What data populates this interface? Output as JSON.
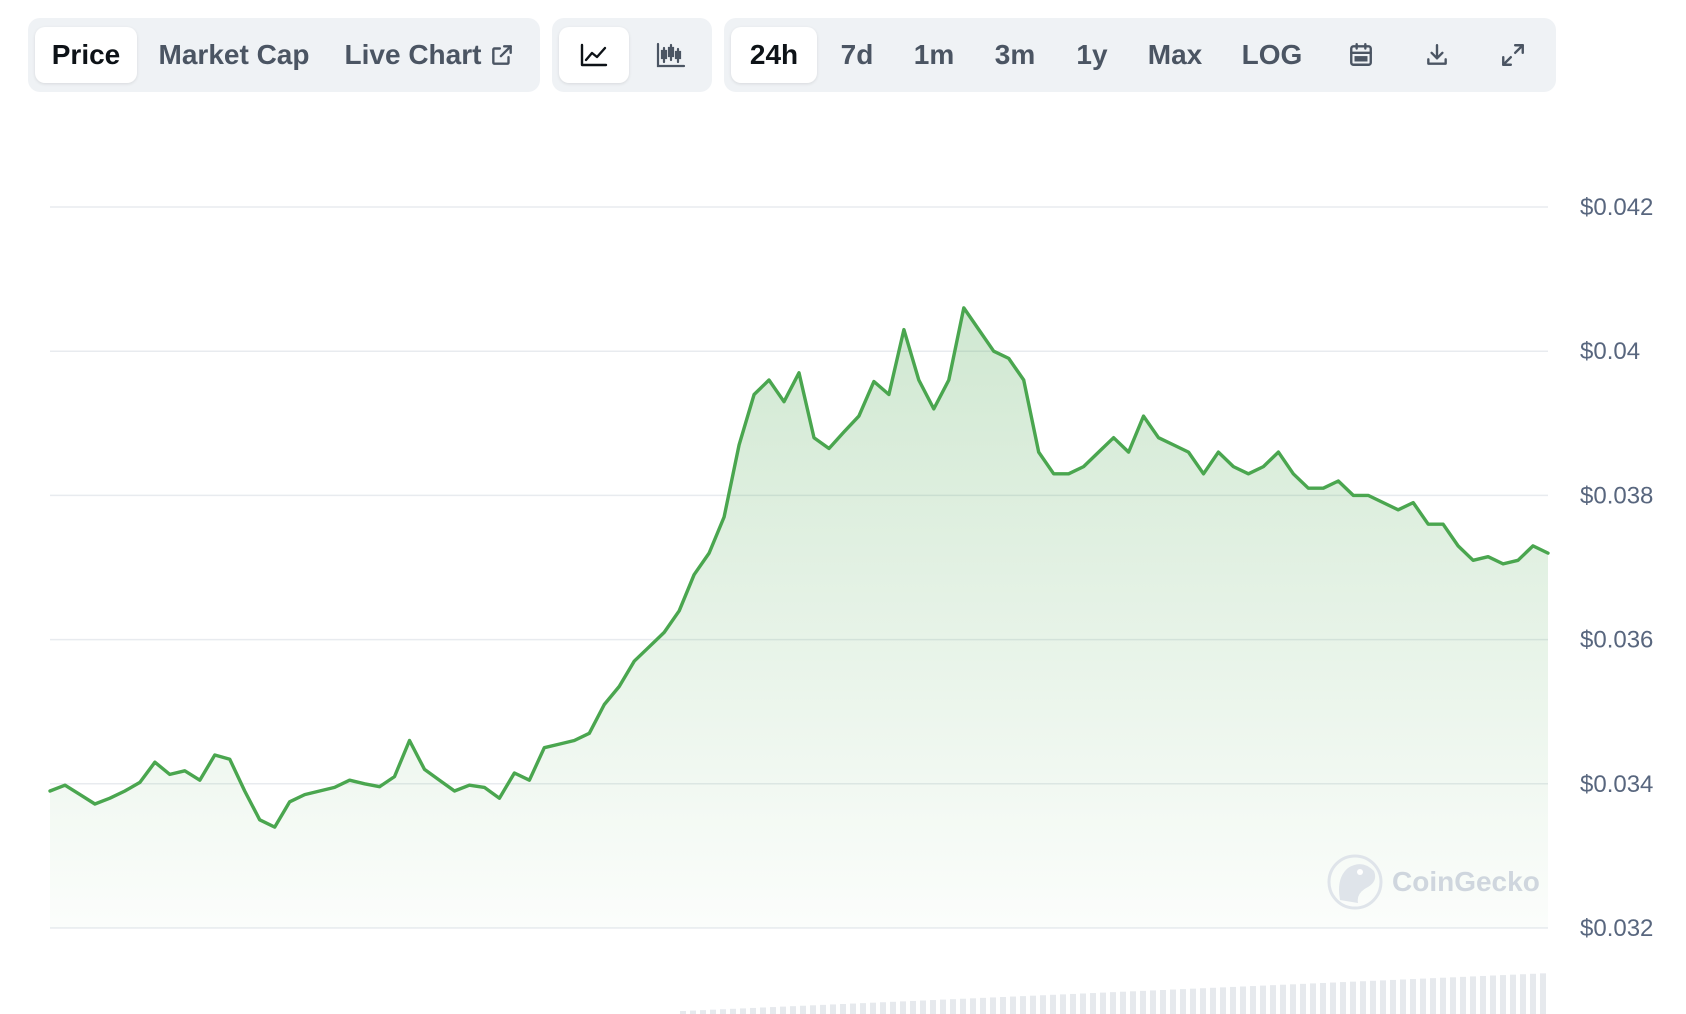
{
  "toolbar": {
    "view_tabs": [
      {
        "label": "Price",
        "active": true
      },
      {
        "label": "Market Cap",
        "active": false
      },
      {
        "label": "Live Chart",
        "active": false,
        "icon": "external-link-icon"
      }
    ],
    "chart_type_buttons": [
      {
        "icon": "line-chart-icon",
        "active": true
      },
      {
        "icon": "candlestick-chart-icon",
        "active": false
      }
    ],
    "ranges": [
      {
        "label": "24h",
        "active": true
      },
      {
        "label": "7d",
        "active": false
      },
      {
        "label": "1m",
        "active": false
      },
      {
        "label": "3m",
        "active": false
      },
      {
        "label": "1y",
        "active": false
      },
      {
        "label": "Max",
        "active": false
      },
      {
        "label": "LOG",
        "active": false
      }
    ],
    "tool_icons": [
      "calendar-icon",
      "download-icon",
      "expand-icon"
    ]
  },
  "watermark": {
    "text": "CoinGecko",
    "icon": "coingecko-logo-icon"
  },
  "colors": {
    "line": "#4aa64f",
    "fill": "#4aa64f",
    "grid": "#e8ebef",
    "axis_text": "#58667e",
    "active_text": "#0d1217",
    "inactive_text": "#4b5563",
    "toolbar_bg": "#eff2f5",
    "volume": "#e6e9ed"
  },
  "chart_data": {
    "type": "area",
    "title": "",
    "xlabel": "",
    "ylabel": "",
    "ylim": [
      0.032,
      0.042
    ],
    "yticks": [
      0.032,
      0.034,
      0.036,
      0.038,
      0.04,
      0.042
    ],
    "ytick_labels": [
      "$0.032",
      "$0.034",
      "$0.036",
      "$0.038",
      "$0.04",
      "$0.042"
    ],
    "grid": true,
    "series": [
      {
        "values": [
          0.0339,
          0.03398,
          0.03385,
          0.03372,
          0.0338,
          0.0339,
          0.03402,
          0.0343,
          0.03413,
          0.03418,
          0.03405,
          0.0344,
          0.03434,
          0.0339,
          0.0335,
          0.0334,
          0.03375,
          0.03385,
          0.0339,
          0.03395,
          0.03405,
          0.034,
          0.03396,
          0.0341,
          0.0346,
          0.0342,
          0.03405,
          0.0339,
          0.03398,
          0.03395,
          0.0338,
          0.03415,
          0.03405,
          0.0345,
          0.03455,
          0.0346,
          0.0347,
          0.0351,
          0.03535,
          0.0357,
          0.0359,
          0.0361,
          0.0364,
          0.0369,
          0.0372,
          0.0377,
          0.0387,
          0.0394,
          0.0396,
          0.0393,
          0.0397,
          0.0388,
          0.03865,
          0.03888,
          0.0391,
          0.03958,
          0.0394,
          0.0403,
          0.0396,
          0.0392,
          0.0396,
          0.0406,
          0.0403,
          0.04,
          0.0399,
          0.0396,
          0.0386,
          0.0383,
          0.0383,
          0.0384,
          0.0386,
          0.0388,
          0.0386,
          0.0391,
          0.0388,
          0.0387,
          0.0386,
          0.0383,
          0.0386,
          0.0384,
          0.0383,
          0.0384,
          0.0386,
          0.0383,
          0.0381,
          0.0381,
          0.0382,
          0.038,
          0.038,
          0.0379,
          0.0378,
          0.0379,
          0.0376,
          0.0376,
          0.0373,
          0.0371,
          0.03715,
          0.03705,
          0.0371,
          0.0373,
          0.0372
        ]
      }
    ]
  }
}
